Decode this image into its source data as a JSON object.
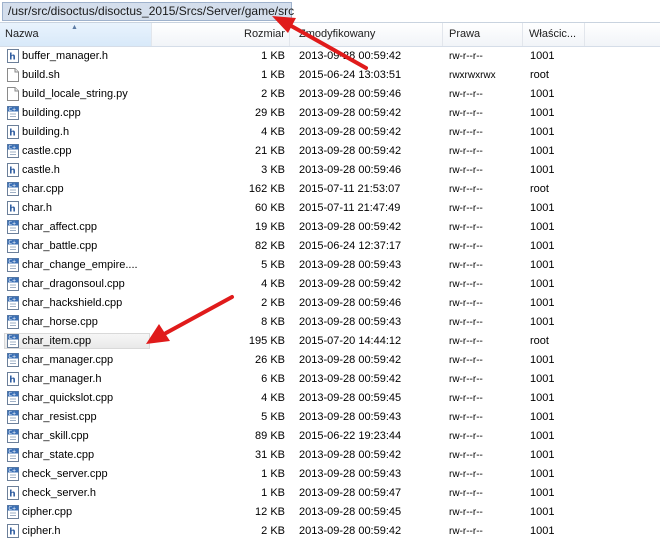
{
  "path": "/usr/src/disoctus/disoctus_2015/Srcs/Server/game/src",
  "columns": {
    "name": "Nazwa",
    "size": "Rozmiar",
    "modified": "Zmodyfikowany",
    "perms": "Prawa",
    "owner": "Właścic..."
  },
  "files": [
    {
      "name": "buffer_manager.h",
      "size": "1 KB",
      "date": "2013-09-28 00:59:42",
      "perms": "rw-r--r--",
      "owner": "1001",
      "icon": "h-file-icon"
    },
    {
      "name": "build.sh",
      "size": "1 KB",
      "date": "2015-06-24 13:03:51",
      "perms": "rwxrwxrwx",
      "owner": "root",
      "icon": "script-file-icon"
    },
    {
      "name": "build_locale_string.py",
      "size": "2 KB",
      "date": "2013-09-28 00:59:46",
      "perms": "rw-r--r--",
      "owner": "1001",
      "icon": "script-file-icon"
    },
    {
      "name": "building.cpp",
      "size": "29 KB",
      "date": "2013-09-28 00:59:42",
      "perms": "rw-r--r--",
      "owner": "1001",
      "icon": "cpp-file-icon"
    },
    {
      "name": "building.h",
      "size": "4 KB",
      "date": "2013-09-28 00:59:42",
      "perms": "rw-r--r--",
      "owner": "1001",
      "icon": "h-file-icon"
    },
    {
      "name": "castle.cpp",
      "size": "21 KB",
      "date": "2013-09-28 00:59:42",
      "perms": "rw-r--r--",
      "owner": "1001",
      "icon": "cpp-file-icon"
    },
    {
      "name": "castle.h",
      "size": "3 KB",
      "date": "2013-09-28 00:59:46",
      "perms": "rw-r--r--",
      "owner": "1001",
      "icon": "h-file-icon"
    },
    {
      "name": "char.cpp",
      "size": "162 KB",
      "date": "2015-07-11 21:53:07",
      "perms": "rw-r--r--",
      "owner": "root",
      "icon": "cpp-file-icon"
    },
    {
      "name": "char.h",
      "size": "60 KB",
      "date": "2015-07-11 21:47:49",
      "perms": "rw-r--r--",
      "owner": "1001",
      "icon": "h-file-icon"
    },
    {
      "name": "char_affect.cpp",
      "size": "19 KB",
      "date": "2013-09-28 00:59:42",
      "perms": "rw-r--r--",
      "owner": "1001",
      "icon": "cpp-file-icon"
    },
    {
      "name": "char_battle.cpp",
      "size": "82 KB",
      "date": "2015-06-24 12:37:17",
      "perms": "rw-r--r--",
      "owner": "1001",
      "icon": "cpp-file-icon"
    },
    {
      "name": "char_change_empire....",
      "size": "5 KB",
      "date": "2013-09-28 00:59:43",
      "perms": "rw-r--r--",
      "owner": "1001",
      "icon": "cpp-file-icon"
    },
    {
      "name": "char_dragonsoul.cpp",
      "size": "4 KB",
      "date": "2013-09-28 00:59:42",
      "perms": "rw-r--r--",
      "owner": "1001",
      "icon": "cpp-file-icon"
    },
    {
      "name": "char_hackshield.cpp",
      "size": "2 KB",
      "date": "2013-09-28 00:59:46",
      "perms": "rw-r--r--",
      "owner": "1001",
      "icon": "cpp-file-icon"
    },
    {
      "name": "char_horse.cpp",
      "size": "8 KB",
      "date": "2013-09-28 00:59:43",
      "perms": "rw-r--r--",
      "owner": "1001",
      "icon": "cpp-file-icon"
    },
    {
      "name": "char_item.cpp",
      "size": "195 KB",
      "date": "2015-07-20 14:44:12",
      "perms": "rw-r--r--",
      "owner": "root",
      "icon": "cpp-file-icon",
      "selected": true
    },
    {
      "name": "char_manager.cpp",
      "size": "26 KB",
      "date": "2013-09-28 00:59:42",
      "perms": "rw-r--r--",
      "owner": "1001",
      "icon": "cpp-file-icon"
    },
    {
      "name": "char_manager.h",
      "size": "6 KB",
      "date": "2013-09-28 00:59:42",
      "perms": "rw-r--r--",
      "owner": "1001",
      "icon": "h-file-icon"
    },
    {
      "name": "char_quickslot.cpp",
      "size": "4 KB",
      "date": "2013-09-28 00:59:45",
      "perms": "rw-r--r--",
      "owner": "1001",
      "icon": "cpp-file-icon"
    },
    {
      "name": "char_resist.cpp",
      "size": "5 KB",
      "date": "2013-09-28 00:59:43",
      "perms": "rw-r--r--",
      "owner": "1001",
      "icon": "cpp-file-icon"
    },
    {
      "name": "char_skill.cpp",
      "size": "89 KB",
      "date": "2015-06-22 19:23:44",
      "perms": "rw-r--r--",
      "owner": "1001",
      "icon": "cpp-file-icon"
    },
    {
      "name": "char_state.cpp",
      "size": "31 KB",
      "date": "2013-09-28 00:59:42",
      "perms": "rw-r--r--",
      "owner": "1001",
      "icon": "cpp-file-icon"
    },
    {
      "name": "check_server.cpp",
      "size": "1 KB",
      "date": "2013-09-28 00:59:43",
      "perms": "rw-r--r--",
      "owner": "1001",
      "icon": "cpp-file-icon"
    },
    {
      "name": "check_server.h",
      "size": "1 KB",
      "date": "2013-09-28 00:59:47",
      "perms": "rw-r--r--",
      "owner": "1001",
      "icon": "h-file-icon"
    },
    {
      "name": "cipher.cpp",
      "size": "12 KB",
      "date": "2013-09-28 00:59:45",
      "perms": "rw-r--r--",
      "owner": "1001",
      "icon": "cpp-file-icon"
    },
    {
      "name": "cipher.h",
      "size": "2 KB",
      "date": "2013-09-28 00:59:42",
      "perms": "rw-r--r--",
      "owner": "1001",
      "icon": "h-file-icon"
    }
  ],
  "colors": {
    "annotation_arrow": "#e01b1b",
    "path_bg": "#d4deec"
  }
}
